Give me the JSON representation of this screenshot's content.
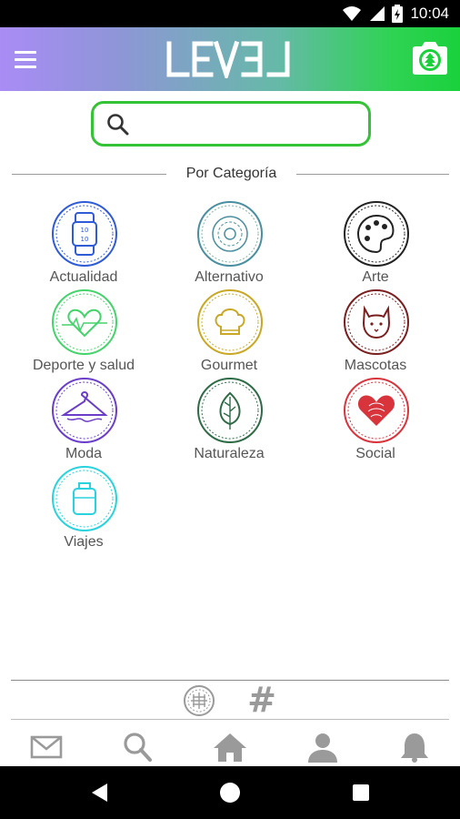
{
  "status_bar": {
    "time": "10:04",
    "icons": [
      "wifi-icon",
      "signal-icon",
      "battery-icon"
    ]
  },
  "app_bar": {
    "logo_text": "LEVEL",
    "menu_icon": "hamburger-menu-icon",
    "camera_icon": "camera-icon",
    "gradient_start": "#a98cf5",
    "gradient_end": "#1ad13c"
  },
  "search": {
    "value": "",
    "placeholder": "",
    "border_color": "#34c236"
  },
  "section": {
    "title": "Por Categoría"
  },
  "categories": [
    {
      "label": "Actualidad",
      "icon": "smartwatch-icon",
      "color": "#2e5bd6"
    },
    {
      "label": "Alternativo",
      "icon": "mandala-icon",
      "color": "#4a8fa0"
    },
    {
      "label": "Arte",
      "icon": "palette-icon",
      "color": "#222222"
    },
    {
      "label": "Deporte y salud",
      "icon": "heartbeat-icon",
      "color": "#45d36b"
    },
    {
      "label": "Gourmet",
      "icon": "chef-hat-icon",
      "color": "#c9a825"
    },
    {
      "label": "Mascotas",
      "icon": "cat-icon",
      "color": "#7a1f1f"
    },
    {
      "label": "Moda",
      "icon": "hanger-icon",
      "color": "#6b3ec9"
    },
    {
      "label": "Naturaleza",
      "icon": "leaf-icon",
      "color": "#2f6b46"
    },
    {
      "label": "Social",
      "icon": "heart-icon",
      "color": "#d8343c"
    },
    {
      "label": "Viajes",
      "icon": "luggage-icon",
      "color": "#29d3de"
    }
  ],
  "view_tabs": [
    {
      "name": "grid-view",
      "icon": "globe-grid-icon"
    },
    {
      "name": "hashtag-view",
      "icon": "hashtag-icon",
      "text": "#"
    }
  ],
  "bottom_nav": [
    {
      "name": "messages",
      "icon": "envelope-icon"
    },
    {
      "name": "search",
      "icon": "search-icon"
    },
    {
      "name": "home",
      "icon": "home-icon"
    },
    {
      "name": "profile",
      "icon": "user-icon"
    },
    {
      "name": "notifications",
      "icon": "bell-icon"
    }
  ],
  "system_nav": [
    "back-icon",
    "home-circle-icon",
    "recents-icon"
  ]
}
